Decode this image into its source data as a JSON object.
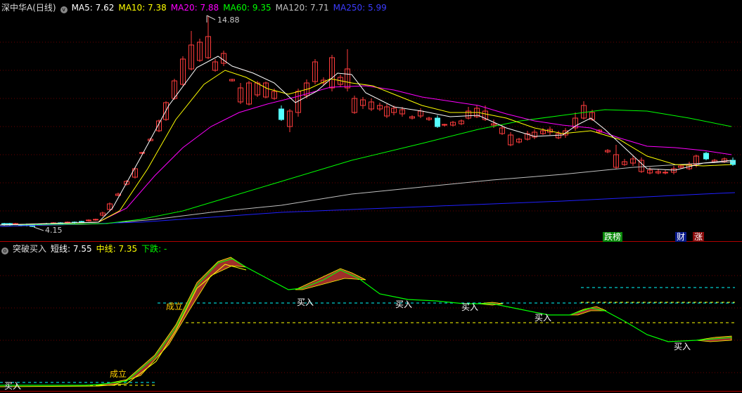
{
  "main": {
    "stock_name": "深中华A(日线)",
    "ma5_label": "MA5: 7.62",
    "ma10_label": "MA10: 7.38",
    "ma20_label": "MA20: 7.88",
    "ma60_label": "MA60: 9.35",
    "ma120_label": "MA120: 7.71",
    "ma250_label": "MA250: 5.99",
    "high_marker": "14.88",
    "low_marker": "4.15",
    "tags": {
      "dieting": "跌榜",
      "cai": "财",
      "zhang": "涨"
    },
    "colors": {
      "ma5": "#ffffff",
      "ma10": "#ffff00",
      "ma20": "#ff00ff",
      "ma60": "#00ff00",
      "ma120": "#c0c0c0",
      "ma250": "#2020ff",
      "up": "#ff3c3c",
      "down": "#54ffff"
    }
  },
  "indicator": {
    "name": "突破买入",
    "short_label": "短线: 7.55",
    "mid_label": "中线: 7.35",
    "down_label": "下跌: -",
    "signals": {
      "buy": "买入",
      "established": "成立"
    }
  }
}
